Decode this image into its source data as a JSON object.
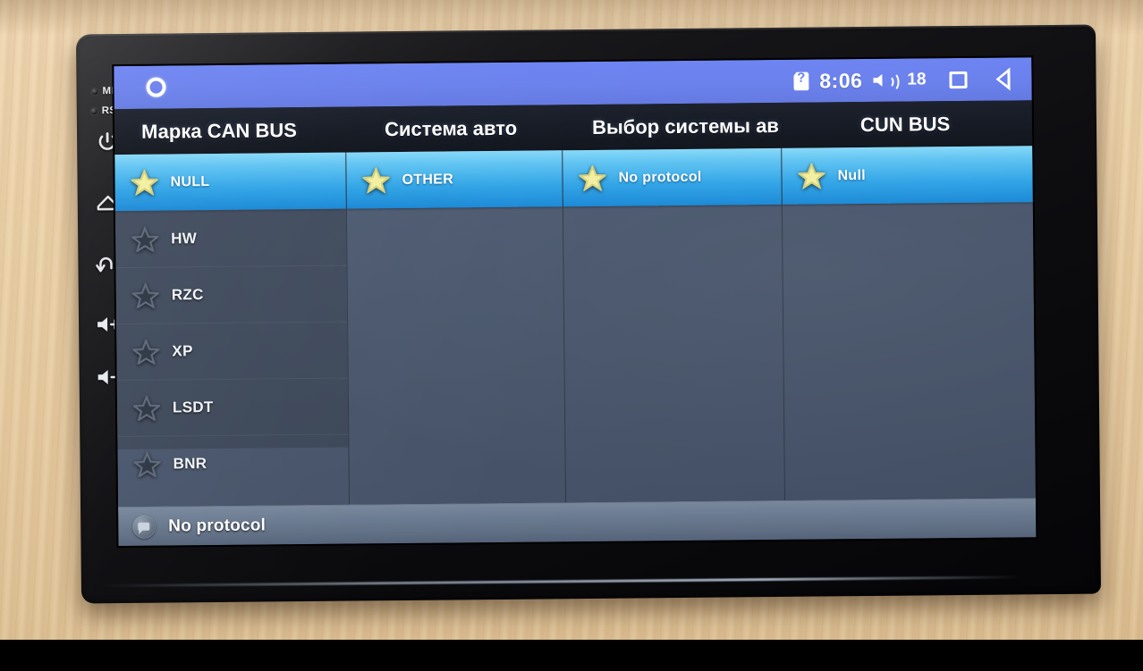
{
  "device": {
    "bezel_buttons": [
      {
        "name": "mic",
        "label": "MIC"
      },
      {
        "name": "reset",
        "label": "RST"
      },
      {
        "name": "power",
        "label": ""
      },
      {
        "name": "home",
        "label": ""
      },
      {
        "name": "back",
        "label": ""
      },
      {
        "name": "volume-up",
        "label": ""
      },
      {
        "name": "volume-down",
        "label": ""
      }
    ]
  },
  "status_bar": {
    "left_icon": "ring-icon",
    "sim_icon": "sim-card-question-icon",
    "time": "8:06",
    "volume_icon": "volume-icon",
    "volume_level": "18",
    "recents_icon": "recents-square-icon",
    "back_icon": "back-triangle-icon",
    "background_color": "#6a80ec"
  },
  "headers": [
    {
      "label": "Марка CAN BUS"
    },
    {
      "label": "Система авто"
    },
    {
      "label": "Выбор системы ав"
    },
    {
      "label": "CUN BUS"
    }
  ],
  "columns": [
    {
      "name": "can-bus-brand",
      "items": [
        {
          "label": "NULL",
          "selected": true
        },
        {
          "label": "HW",
          "selected": false
        },
        {
          "label": "RZC",
          "selected": false
        },
        {
          "label": "XP",
          "selected": false
        },
        {
          "label": "LSDT",
          "selected": false
        },
        {
          "label": "BNR",
          "selected": false
        }
      ]
    },
    {
      "name": "car-system",
      "items": [
        {
          "label": "OTHER",
          "selected": true
        }
      ]
    },
    {
      "name": "system-choice",
      "items": [
        {
          "label": "No protocol",
          "selected": true
        }
      ]
    },
    {
      "name": "cun-bus",
      "items": [
        {
          "label": "Null",
          "selected": true
        }
      ]
    }
  ],
  "bottom_bar": {
    "icon": "chat-bubble-icon",
    "label": "No protocol"
  },
  "colors": {
    "status_bar": "#6a80ec",
    "header_bar": "#141822",
    "content_bg": "#49566c",
    "list_bg": "#3e4a5c",
    "selected_row_top": "#86d8f8",
    "selected_row_bottom": "#1787d6",
    "star_selected": "#f2efa0",
    "star_unselected": "#2b3442",
    "bottom_bar": "#6b7b91",
    "desk": "#e9cfa6"
  }
}
